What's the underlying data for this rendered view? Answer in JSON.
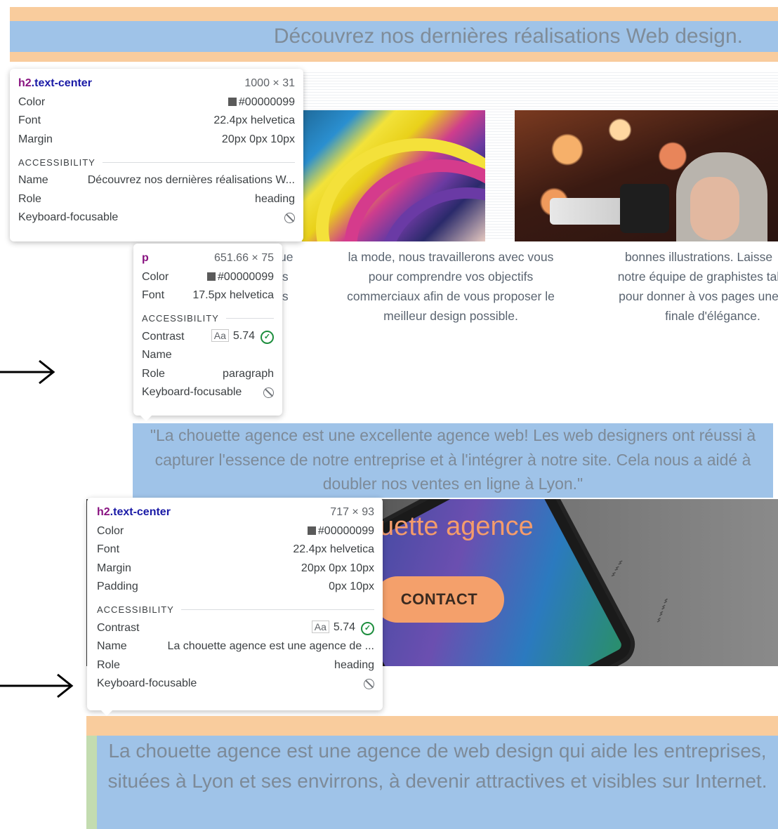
{
  "top_heading": {
    "text": "Découvrez nos dernières réalisations Web design."
  },
  "col_middle_lines": [
    "la mode, nous travaillerons avec vous",
    "pour comprendre vos objectifs",
    "commerciaux afin de vous proposer le",
    "meilleur design possible."
  ],
  "col_right_lines": [
    "bonnes illustrations. Laisse",
    "notre équipe de graphistes tal",
    "pour donner à vos pages une",
    "finale d'élégance."
  ],
  "col_left_fragments": [
    "ue",
    "is",
    "is"
  ],
  "tooltip_h2_top": {
    "selector_tag": "h2",
    "selector_class": ".text-center",
    "size": "1000 × 31",
    "color_label": "Color",
    "color_value": "#00000099",
    "font_label": "Font",
    "font_value": "22.4px helvetica",
    "margin_label": "Margin",
    "margin_value": "20px 0px 10px",
    "section": "ACCESSIBILITY",
    "name_label": "Name",
    "name_value": "Découvrez nos dernières réalisations W...",
    "role_label": "Role",
    "role_value": "heading",
    "focus_label": "Keyboard-focusable"
  },
  "tooltip_p": {
    "selector_tag": "p",
    "size": "651.66 × 75",
    "color_label": "Color",
    "color_value": "#00000099",
    "font_label": "Font",
    "font_value": "17.5px helvetica",
    "section": "ACCESSIBILITY",
    "contrast_label": "Contrast",
    "contrast_aa": "Aa",
    "contrast_value": "5.74",
    "name_label": "Name",
    "name_value": "",
    "role_label": "Role",
    "role_value": "paragraph",
    "focus_label": "Keyboard-focusable"
  },
  "quote": {
    "text": "\"La chouette agence est une excellente agence web! Les web designers ont réussi à capturer l'essence de notre entreprise et à l'intégrer à notre site. Cela nous a aidé à doubler nos ventes en ligne à Lyon.\""
  },
  "hero": {
    "title_fragment": "uette agence",
    "contact_label": "CONTACT"
  },
  "tooltip_h2_bottom": {
    "selector_tag": "h2",
    "selector_class": ".text-center",
    "size": "717 × 93",
    "color_label": "Color",
    "color_value": "#00000099",
    "font_label": "Font",
    "font_value": "22.4px helvetica",
    "margin_label": "Margin",
    "margin_value": "20px 0px 10px",
    "padding_label": "Padding",
    "padding_value": "0px 10px",
    "section": "ACCESSIBILITY",
    "contrast_label": "Contrast",
    "contrast_aa": "Aa",
    "contrast_value": "5.74",
    "name_label": "Name",
    "name_value": "La chouette agence est une agence de ...",
    "role_label": "Role",
    "role_value": "heading",
    "focus_label": "Keyboard-focusable"
  },
  "bottom_heading": {
    "text": "La chouette agence est une agence de web design qui aide les entreprises, situées à Lyon et ses envirrons, à devenir attractives et visibles sur Internet."
  },
  "icons": {
    "arrow": "right-arrow-icon",
    "not_focusable": "not-allowed-icon",
    "contrast_ok": "check-circle-icon",
    "color": "color-swatch-icon"
  },
  "colors": {
    "margin_overlay": "#f9cc9d",
    "content_overlay": "#9fc3e8",
    "padding_overlay": "#c3dcb0",
    "accent": "#f4a06b"
  }
}
